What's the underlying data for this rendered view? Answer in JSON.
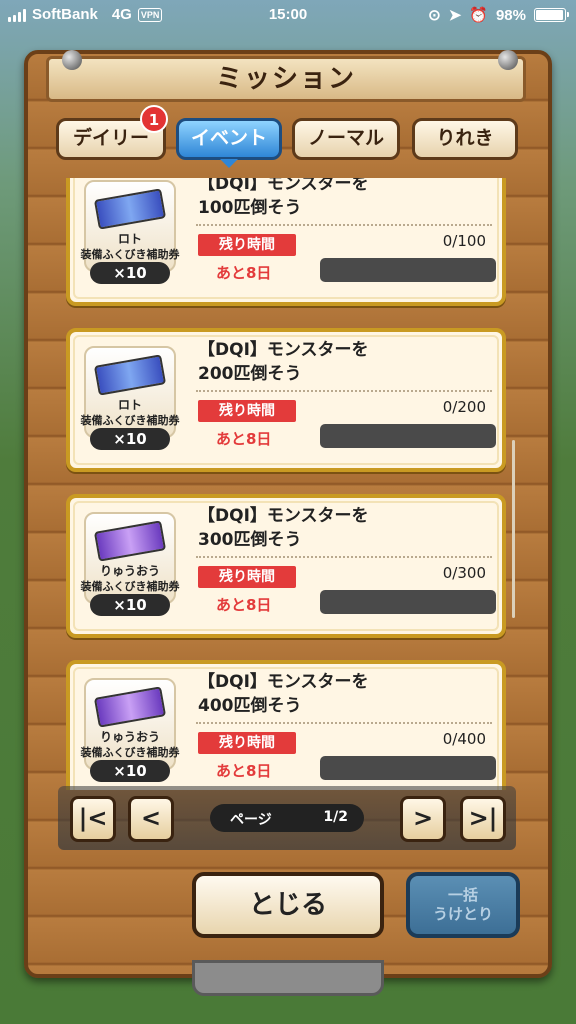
{
  "status": {
    "carrier": "SoftBank",
    "network": "4G",
    "vpn": "VPN",
    "time": "15:00",
    "battery": "98%",
    "battery_level": 0.98
  },
  "header": {
    "title": "ミッション"
  },
  "tabs": [
    {
      "label": "デイリー",
      "badge": "1"
    },
    {
      "label": "イベント",
      "active": true
    },
    {
      "label": "ノーマル"
    },
    {
      "label": "りれき"
    }
  ],
  "missions": [
    {
      "title": "【DQⅠ】モンスターを\n100匹倒そう",
      "reward_name": "ロト",
      "reward_type": "装備ふくびき補助券",
      "qty": "×10",
      "remaining_label": "残り時間",
      "days": "あと8日",
      "progress": "0/100",
      "progress_fraction": 0,
      "ticket_color": "blue"
    },
    {
      "title": "【DQⅠ】モンスターを\n200匹倒そう",
      "reward_name": "ロト",
      "reward_type": "装備ふくびき補助券",
      "qty": "×10",
      "remaining_label": "残り時間",
      "days": "あと8日",
      "progress": "0/200",
      "progress_fraction": 0,
      "ticket_color": "blue"
    },
    {
      "title": "【DQⅠ】モンスターを\n300匹倒そう",
      "reward_name": "りゅうおう",
      "reward_type": "装備ふくびき補助券",
      "qty": "×10",
      "remaining_label": "残り時間",
      "days": "あと8日",
      "progress": "0/300",
      "progress_fraction": 0,
      "ticket_color": "purple"
    },
    {
      "title": "【DQⅠ】モンスターを\n400匹倒そう",
      "reward_name": "りゅうおう",
      "reward_type": "装備ふくびき補助券",
      "qty": "×10",
      "remaining_label": "残り時間",
      "days": "あと8日",
      "progress": "0/400",
      "progress_fraction": 0,
      "ticket_color": "purple"
    }
  ],
  "pager": {
    "label": "ページ",
    "value": "1/2",
    "first_icon": "first-page-icon",
    "prev_icon": "prev-page-icon",
    "next_icon": "next-page-icon",
    "last_icon": "last-page-icon"
  },
  "buttons": {
    "close": "とじる",
    "claim_line1": "一括",
    "claim_line2": "うけとり"
  }
}
